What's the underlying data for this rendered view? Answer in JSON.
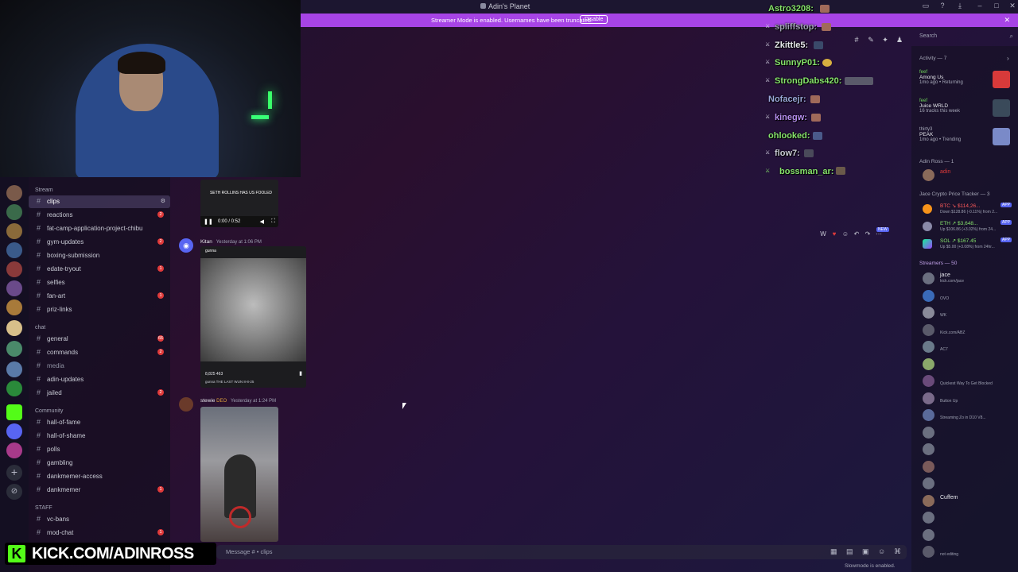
{
  "window": {
    "title": "Adin's Planet"
  },
  "banner": {
    "message": "Streamer Mode is enabled. Usernames have been truncated.",
    "disable_label": "Disable"
  },
  "channel_categories": {
    "stream": "Stream",
    "chat": "chat",
    "community": "Community",
    "staff": "STAFF"
  },
  "channels": [
    {
      "name": "clips",
      "badge": "",
      "active": true
    },
    {
      "name": "reactions",
      "badge": "2"
    },
    {
      "name": "fat-camp-application-project-chibu",
      "badge": ""
    },
    {
      "name": "gym-updates",
      "badge": "2"
    },
    {
      "name": "boxing-submission",
      "badge": ""
    },
    {
      "name": "edate-tryout",
      "badge": "1"
    },
    {
      "name": "selfies",
      "badge": ""
    },
    {
      "name": "fan-art",
      "badge": "1"
    },
    {
      "name": "priz-links",
      "badge": ""
    },
    {
      "name": "general",
      "badge": "66"
    },
    {
      "name": "commands",
      "badge": "2"
    },
    {
      "name": "media",
      "badge": ""
    },
    {
      "name": "adin-updates",
      "badge": ""
    },
    {
      "name": "jailed",
      "badge": "2"
    },
    {
      "name": "hall-of-fame",
      "badge": ""
    },
    {
      "name": "hall-of-shame",
      "badge": ""
    },
    {
      "name": "polls",
      "badge": ""
    },
    {
      "name": "gambling",
      "badge": ""
    },
    {
      "name": "dankmemer-access",
      "badge": ""
    },
    {
      "name": "dankmemer",
      "badge": "1"
    },
    {
      "name": "vc-bans",
      "badge": ""
    },
    {
      "name": "mod-chat",
      "badge": "1"
    }
  ],
  "messages": [
    {
      "video_time": "0:00 / 0:52",
      "video_caption": "SETH ROLLINS HAS US FOOLED"
    },
    {
      "author": "Kitan",
      "time": "Yesterday at 1:06 PM",
      "post_user": "gunna",
      "post_stats": "8,825   463",
      "post_caption": "gunna THE LAST WUN 8-8-25"
    },
    {
      "author": "stewie",
      "tag": "DEO",
      "time": "Yesterday at 1:24 PM"
    }
  ],
  "chat_overlay": [
    {
      "name": "Astro3208:",
      "color": "#86e36b"
    },
    {
      "name": "spliffstop:",
      "color": "#9ea1b2"
    },
    {
      "name": "Zkittle5:",
      "color": "#e6e7ec"
    },
    {
      "name": "SunnyP01:",
      "color": "#86e36b"
    },
    {
      "name": "StrongDabs420:",
      "color": "#86e36b"
    },
    {
      "name": "Nofacejr:",
      "color": "#9aa8d8"
    },
    {
      "name": "kinegw:",
      "color": "#b78ff0"
    },
    {
      "name": "ohlooked:",
      "color": "#86e36b"
    },
    {
      "name": "flow7:",
      "color": "#c7c9d3"
    },
    {
      "name": "bossman_ar:",
      "color": "#86e36b"
    }
  ],
  "search": {
    "placeholder": "Search"
  },
  "activity": {
    "header": "Activity — 7",
    "items": [
      {
        "user": "feef",
        "game": "Among Us",
        "sub": "1mo ago  •  Returning"
      },
      {
        "user": "feef",
        "game": "Juice WRLD",
        "sub": "16 tracks this week"
      },
      {
        "user": "thirty3",
        "game": "PEAK",
        "sub": "1mo ago  •  Trending"
      }
    ]
  },
  "adin_ross_section": {
    "header": "Adin Ross — 1",
    "member": "adin"
  },
  "crypto": {
    "header": "Jace Crypto Price Tracker — 3",
    "items": [
      {
        "line": "BTC ↘ $114,26...",
        "sub": "Down $128.86 (-0.11%) from 2...",
        "app": "APP"
      },
      {
        "line": "ETH ↗ $3,648...",
        "sub": "Up $106.86 (+3.02%) from 24...",
        "app": "APP"
      },
      {
        "line": "SOL ↗ $167.45",
        "sub": "Up $5.00 (+3.08%) from 24hr...",
        "app": "APP"
      }
    ]
  },
  "streamers": {
    "header": "Streamers — 50",
    "items": [
      {
        "name": "jace",
        "sub": "kick.com/jace"
      },
      {
        "name": "",
        "sub": "OVO"
      },
      {
        "name": "",
        "sub": "WK"
      },
      {
        "name": "",
        "sub": "Kick.com/ABZ"
      },
      {
        "name": "",
        "sub": "AC7"
      },
      {
        "name": "",
        "sub": ""
      },
      {
        "name": "",
        "sub": "Quickest Way To Get Blocked"
      },
      {
        "name": "",
        "sub": "Button Up"
      },
      {
        "name": "",
        "sub": "Streaming Zo in D10 V8..."
      },
      {
        "name": "",
        "sub": ""
      },
      {
        "name": "",
        "sub": ""
      },
      {
        "name": "",
        "sub": ""
      },
      {
        "name": "",
        "sub": ""
      },
      {
        "name": "Cuffem",
        "sub": ""
      },
      {
        "name": "",
        "sub": ""
      },
      {
        "name": "",
        "sub": ""
      },
      {
        "name": "",
        "sub": "not editing"
      }
    ]
  },
  "composer": {
    "placeholder": "Message # • clips"
  },
  "slowmode": "Slowmode is enabled.",
  "watermark": {
    "logo": "K",
    "url": "KICK.COM/ADINROSS"
  },
  "new_tag": "NEW"
}
